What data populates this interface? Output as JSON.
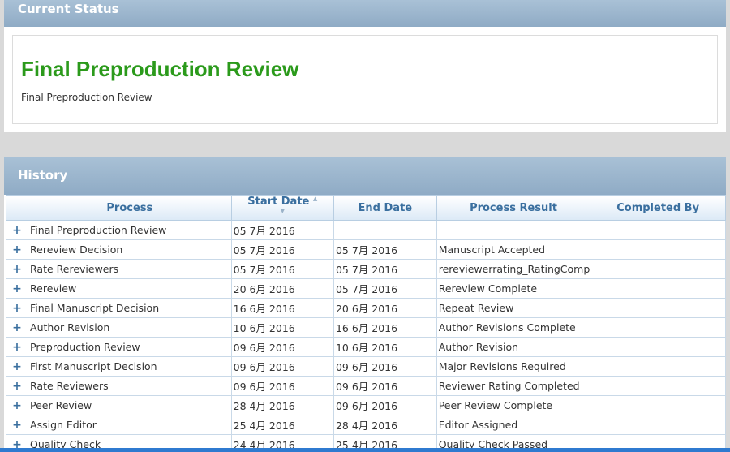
{
  "current_status": {
    "header": "Current Status",
    "title": "Final Preproduction Review",
    "subtitle": "Final Preproduction Review"
  },
  "history": {
    "header": "History",
    "columns": [
      "Process",
      "Start Date",
      "End Date",
      "Process Result",
      "Completed By"
    ],
    "expand_glyph": "+",
    "rows": [
      {
        "process": "Final Preproduction Review",
        "start": "05 7月 2016",
        "end": "",
        "result": "",
        "by": ""
      },
      {
        "process": "Rereview Decision",
        "start": "05 7月 2016",
        "end": "05 7月 2016",
        "result": "Manuscript Accepted",
        "by": ""
      },
      {
        "process": "Rate Rereviewers",
        "start": "05 7月 2016",
        "end": "05 7月 2016",
        "result": "rereviewerrating_RatingComp",
        "by": ""
      },
      {
        "process": "Rereview",
        "start": "20 6月 2016",
        "end": "05 7月 2016",
        "result": "Rereview Complete",
        "by": ""
      },
      {
        "process": "Final Manuscript Decision",
        "start": "16 6月 2016",
        "end": "20 6月 2016",
        "result": "Repeat Review",
        "by": ""
      },
      {
        "process": "Author Revision",
        "start": "10 6月 2016",
        "end": "16 6月 2016",
        "result": "Author Revisions Complete",
        "by": ""
      },
      {
        "process": "Preproduction Review",
        "start": "09 6月 2016",
        "end": "10 6月 2016",
        "result": "Author Revision",
        "by": ""
      },
      {
        "process": "First Manuscript Decision",
        "start": "09 6月 2016",
        "end": "09 6月 2016",
        "result": "Major Revisions Required",
        "by": ""
      },
      {
        "process": "Rate Reviewers",
        "start": "09 6月 2016",
        "end": "09 6月 2016",
        "result": "Reviewer Rating Completed",
        "by": ""
      },
      {
        "process": "Peer Review",
        "start": "28 4月 2016",
        "end": "09 6月 2016",
        "result": "Peer Review Complete",
        "by": ""
      },
      {
        "process": "Assign Editor",
        "start": "25 4月 2016",
        "end": "28 4月 2016",
        "result": "Editor Assigned",
        "by": ""
      },
      {
        "process": "Quality Check",
        "start": "24 4月 2016",
        "end": "25 4月 2016",
        "result": "Quality Check Passed",
        "by": ""
      }
    ]
  }
}
